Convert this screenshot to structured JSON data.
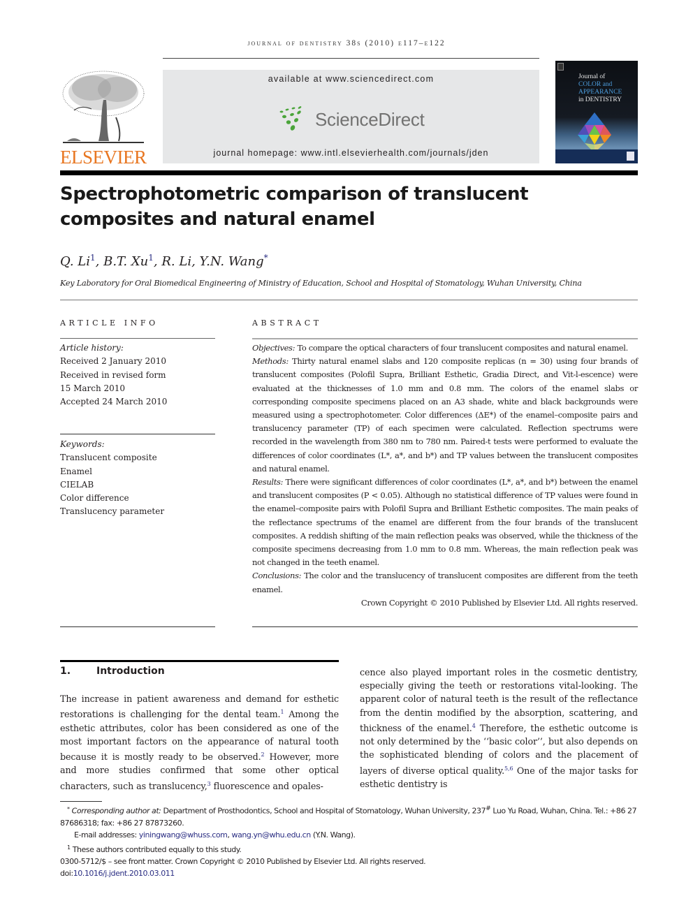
{
  "running_head": "journal of dentistry 38s (2010) e117–e122",
  "publisher": {
    "name": "ELSEVIER",
    "logo_icon": "elsevier-tree-icon",
    "brand_color": "#e87722"
  },
  "banner": {
    "available_at": "available at www.sciencedirect.com",
    "logo_text": "ScienceDirect",
    "logo_icon": "sciencedirect-dots-icon",
    "logo_accent": "#4aa43a",
    "homepage": "journal homepage: www.intl.elsevierhealth.com/journals/jden"
  },
  "cover": {
    "title_line1": "Journal of",
    "title_line2": "COLOR and",
    "title_line3": "APPEARANCE",
    "title_line4": "in DENTISTRY"
  },
  "article": {
    "title": "Spectrophotometric comparison of translucent composites and natural enamel",
    "authors": [
      {
        "name": "Q. Li",
        "mark": "1"
      },
      {
        "name": "B.T. Xu",
        "mark": "1"
      },
      {
        "name": "R. Li",
        "mark": ""
      },
      {
        "name": "Y.N. Wang",
        "mark": "*"
      }
    ],
    "affiliation": "Key Laboratory for Oral Biomedical Engineering of Ministry of Education, School and Hospital of Stomatology, Wuhan University, China"
  },
  "article_info": {
    "heading": "ARTICLE INFO",
    "history_label": "Article history:",
    "history": [
      "Received 2 January 2010",
      "Received in revised form",
      "15 March 2010",
      "Accepted 24 March 2010"
    ],
    "keywords_label": "Keywords:",
    "keywords": [
      "Translucent composite",
      "Enamel",
      "CIELAB",
      "Color difference",
      "Translucency parameter"
    ]
  },
  "abstract": {
    "heading": "ABSTRACT",
    "objectives_label": "Objectives:",
    "objectives": "To compare the optical characters of four translucent composites and natural enamel.",
    "methods_label": "Methods:",
    "methods": "Thirty natural enamel slabs and 120 composite replicas (n = 30) using four brands of translucent composites (Polofil Supra, Brilliant Esthetic, Gradia Direct, and Vit-l-escence) were evaluated at the thicknesses of 1.0 mm and 0.8 mm. The colors of the enamel slabs or corresponding composite specimens placed on an A3 shade, white and black backgrounds were measured using a spectrophotometer. Color differences (ΔE*) of the enamel–composite pairs and translucency parameter (TP) of each specimen were calculated. Reflection spectrums were recorded in the wavelength from 380 nm to 780 nm. Paired-t tests were performed to evaluate the differences of color coordinates (L*, a*, and b*) and TP values between the translucent composites and natural enamel.",
    "results_label": "Results:",
    "results": "There were significant differences of color coordinates (L*, a*, and b*) between the enamel and translucent composites (P < 0.05). Although no statistical difference of TP values were found in the enamel–composite pairs with Polofil Supra and Brilliant Esthetic composites. The main peaks of the reflectance spectrums of the enamel are different from the four brands of the translucent composites. A reddish shifting of the main reflection peaks was observed, while the thickness of the composite specimens decreasing from 1.0 mm to 0.8 mm. Whereas, the main reflection peak was not changed in the teeth enamel.",
    "conclusions_label": "Conclusions:",
    "conclusions": "The color and the translucency of translucent composites are different from the teeth enamel.",
    "copyright": "Crown Copyright © 2010 Published by Elsevier Ltd. All rights reserved."
  },
  "introduction": {
    "number": "1.",
    "heading": "Introduction",
    "left_parts": [
      "The increase in patient awareness and demand for esthetic restorations is challenging for the dental team.",
      " Among the esthetic attributes, color has been considered as one of the most important factors on the appearance of natural tooth because it is mostly ready to be observed.",
      " However, more and more studies confirmed that some other optical characters, such as translucency,",
      " fluorescence and opales-"
    ],
    "left_refs": [
      "1",
      "2",
      "3"
    ],
    "right_parts": [
      "cence also played important roles in the cosmetic dentistry, especially giving the teeth or restorations vital-looking. The apparent color of natural teeth is the result of the reflectance from the dentin modified by the absorption, scattering, and thickness of the enamel.",
      " Therefore, the esthetic outcome is not only determined by the ‘‘basic color’’, but also depends on the sophisticated blending of colors and the placement of layers of diverse optical quality.",
      " One of the major tasks for esthetic dentistry is"
    ],
    "right_refs": [
      "4",
      "5,6"
    ]
  },
  "footnotes": {
    "corr_mark": "*",
    "corr_label": "Corresponding author at:",
    "corr_text": " Department of Prosthodontics, School and Hospital of Stomatology, Wuhan University, 237",
    "corr_sup": "#",
    "corr_text2": " Luo Yu Road, Wuhan, China. Tel.: +86 27 87686318; fax: +86 27 87873260.",
    "email_label": "E-mail addresses: ",
    "email1": "yiningwang@whuss.com",
    "email_sep": ", ",
    "email2": "wang.yn@whu.edu.cn",
    "email_suffix": " (Y.N. Wang).",
    "equal_mark": "1",
    "equal_text": "These authors contributed equally to this study.",
    "issn_line": "0300-5712/$ – see front matter. Crown Copyright © 2010 Published by Elsevier Ltd. All rights reserved.",
    "doi_label": "doi:",
    "doi": "10.1016/j.jdent.2010.03.011"
  }
}
